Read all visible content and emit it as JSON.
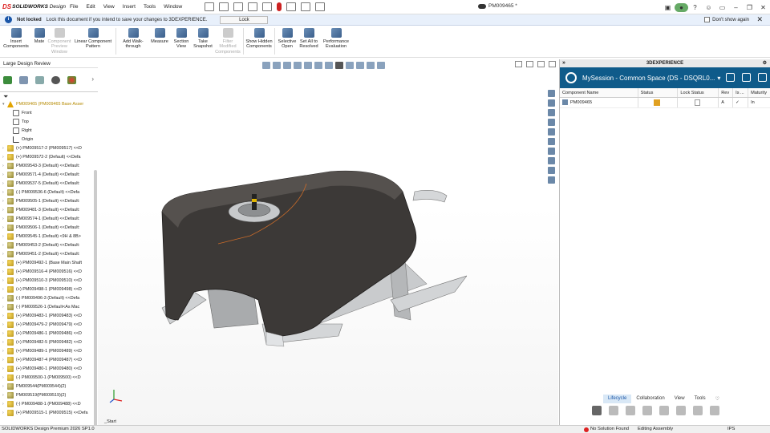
{
  "app": {
    "brand_ds": "DS",
    "brand_name": "SOLIDWORKS",
    "brand_suffix": "Design",
    "document_title": "PM009465 *"
  },
  "menu": [
    "File",
    "Edit",
    "View",
    "Insert",
    "Tools",
    "Window"
  ],
  "notice": {
    "status": "Not locked",
    "message": "Lock this document if you intend to save your changes to 3DEXPERIENCE.",
    "lock_button": "Lock",
    "dont_show": "Don't show again"
  },
  "ribbon": [
    {
      "label": "Insert Components",
      "enabled": true
    },
    {
      "label": "Mate",
      "enabled": true
    },
    {
      "label": "Component Preview Window",
      "enabled": false
    },
    {
      "label": "Linear Component Pattern",
      "enabled": true
    },
    {
      "label": "Add Walk-through",
      "enabled": true
    },
    {
      "label": "Measure",
      "enabled": true
    },
    {
      "label": "Section View",
      "enabled": true
    },
    {
      "label": "Take Snapshot",
      "enabled": true
    },
    {
      "label": "Filter Modified Components",
      "enabled": false
    },
    {
      "label": "Show Hidden Components",
      "enabled": true
    },
    {
      "label": "Selective Open",
      "enabled": true
    },
    {
      "label": "Set All to Resolved",
      "enabled": true
    },
    {
      "label": "Performance Evaluation",
      "enabled": true
    }
  ],
  "left_panel": {
    "title": "Large Design Review",
    "root": "PM009465 (PM009465 Base Asser",
    "nodes": [
      {
        "label": "Front",
        "type": "plane"
      },
      {
        "label": "Top",
        "type": "plane"
      },
      {
        "label": "Right",
        "type": "plane"
      },
      {
        "label": "Origin",
        "type": "origin"
      },
      {
        "label": "(+) PM009517-2 (PM009517) <<D",
        "type": "asm"
      },
      {
        "label": "(+) PM009572-2 (Default) <<Defa",
        "type": "asm"
      },
      {
        "label": "PM009543-3 (Default) <<Default:",
        "type": "part"
      },
      {
        "label": "PM009571-4 (Default) <<Default:",
        "type": "part"
      },
      {
        "label": "PM009537-5 (Default) <<Default:",
        "type": "part"
      },
      {
        "label": "(-) PM009536-6 (Default) <<Defa",
        "type": "part"
      },
      {
        "label": "PM009505-1 (Default) <<Default:",
        "type": "part"
      },
      {
        "label": "PM009481-3 (Default) <<Default:",
        "type": "part"
      },
      {
        "label": "PM009574-1 (Default) <<Default:",
        "type": "part"
      },
      {
        "label": "PM009506-1 (Default) <<Default:",
        "type": "part"
      },
      {
        "label": "PM009545-1 (Default) <9H & 8B>",
        "type": "asm"
      },
      {
        "label": "PM009453-2 (Default) <<Default:",
        "type": "part"
      },
      {
        "label": "PM009451-2 (Default) <<Default:",
        "type": "part"
      },
      {
        "label": "(+) PM009492-1 (Base Main Shaft",
        "type": "asm"
      },
      {
        "label": "(+) PM009516-4 (PM009516) <<D",
        "type": "asm"
      },
      {
        "label": "(+) PM009510-3 (PM009510) <<D",
        "type": "asm"
      },
      {
        "label": "(+) PM009498-1 (PM009498) <<D",
        "type": "asm"
      },
      {
        "label": "(-) PM009496-3 (Default) <<Defa",
        "type": "part"
      },
      {
        "label": "(-) PM009526-1 (Default<As Mac",
        "type": "part"
      },
      {
        "label": "(+) PM009483-1 (PM009483) <<D",
        "type": "asm"
      },
      {
        "label": "(+) PM009479-2 (PM009479) <<D",
        "type": "asm"
      },
      {
        "label": "(+) PM009486-1 (PM009486) <<D",
        "type": "asm"
      },
      {
        "label": "(+) PM009482-5 (PM009482) <<D",
        "type": "asm"
      },
      {
        "label": "(+) PM009489-1 (PM009489) <<D",
        "type": "asm"
      },
      {
        "label": "(+) PM009487-4 (PM009487) <<D",
        "type": "asm"
      },
      {
        "label": "(+) PM009480-1 (PM009480) <<D",
        "type": "asm"
      },
      {
        "label": "(-) PM009500-1 (PM009500) <<D",
        "type": "asm"
      },
      {
        "label": "PM009544(PM009544)(2)",
        "type": "part"
      },
      {
        "label": "PM009519(PM009519)(2)",
        "type": "part"
      },
      {
        "label": "(-) PM009488-1 (PM009488) <<D",
        "type": "asm"
      },
      {
        "label": "(+) PM009515-1 (PM009515) <<Defa",
        "type": "asm"
      }
    ]
  },
  "viewport": {
    "start_label": "_Start"
  },
  "right_panel": {
    "title": "3DEXPERIENCE",
    "session": "MySession - Common Space (DS - DSQRL0...",
    "columns": [
      "Component Name",
      "Status",
      "Lock Status",
      "Rev",
      "Is ...",
      "Maturity"
    ],
    "rows": [
      {
        "name": "PM009465",
        "rev": "A",
        "is": "✓",
        "maturity": "In"
      }
    ],
    "tabs": [
      "Lifecycle",
      "Collaboration",
      "View",
      "Tools"
    ],
    "active_tab": "Lifecycle"
  },
  "status_bar": {
    "product": "SOLIDWORKS Design Premium 2026 SP1.0",
    "error": "No Solution Found",
    "mode": "Editing Assembly",
    "units": "IPS"
  }
}
